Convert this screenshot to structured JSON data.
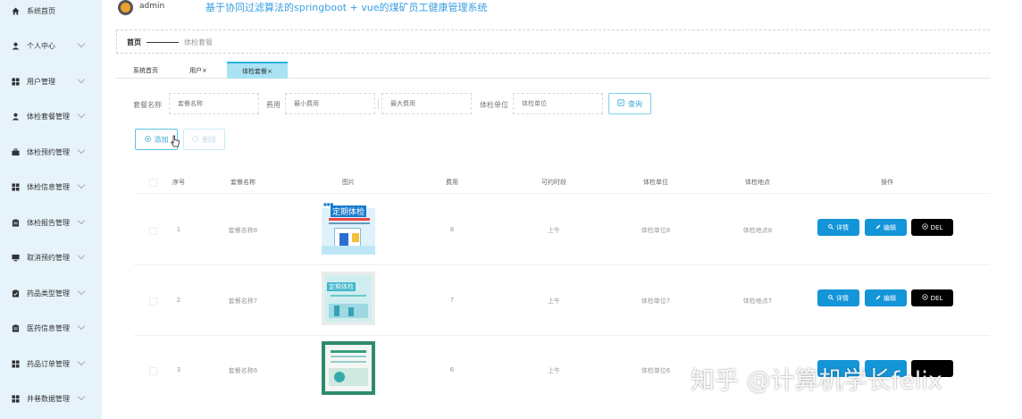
{
  "sidebar": {
    "items": [
      {
        "label": "系统首页",
        "icon": "home-icon",
        "chevron": false
      },
      {
        "label": "个人中心",
        "icon": "user-icon",
        "chevron": true
      },
      {
        "label": "用户管理",
        "icon": "grid-icon",
        "chevron": true
      },
      {
        "label": "体检套餐管理",
        "icon": "user-icon",
        "chevron": true
      },
      {
        "label": "体检预约管理",
        "icon": "briefcase-icon",
        "chevron": true
      },
      {
        "label": "体检信息管理",
        "icon": "grid-icon",
        "chevron": true
      },
      {
        "label": "体检报告管理",
        "icon": "clipboard-icon",
        "chevron": true
      },
      {
        "label": "取消预约管理",
        "icon": "monitor-icon",
        "chevron": true
      },
      {
        "label": "药品类型管理",
        "icon": "clipboard-check-icon",
        "chevron": true
      },
      {
        "label": "医药信息管理",
        "icon": "clipboard-icon",
        "chevron": true
      },
      {
        "label": "药品订单管理",
        "icon": "grid-icon",
        "chevron": true
      },
      {
        "label": "井巷数据管理",
        "icon": "grid-icon",
        "chevron": true
      }
    ]
  },
  "header": {
    "username": "admin",
    "system_title": "基于协同过滤算法的springboot + vue的煤矿员工健康管理系统"
  },
  "breadcrumb": {
    "home": "首页",
    "current": "体检套餐"
  },
  "tabs": [
    {
      "label": "系统首页",
      "active": false
    },
    {
      "label": "用户×",
      "active": false
    },
    {
      "label": "体检套餐×",
      "active": true
    }
  ],
  "search": {
    "name_label": "套餐名称",
    "name_placeholder": "套餐名称",
    "fee_label": "费用",
    "min_fee_placeholder": "最小费用",
    "max_fee_placeholder": "最大费用",
    "unit_label": "体检单位",
    "unit_placeholder": "体检单位",
    "query_label": "查询"
  },
  "actions": {
    "add_label": "添加",
    "delete_label": "删除"
  },
  "table": {
    "headers": [
      "序号",
      "套餐名称",
      "图片",
      "费用",
      "可约时段",
      "体检单位",
      "体检地点",
      "操作"
    ],
    "rows": [
      {
        "index": "1",
        "name": "套餐名称8",
        "fee": "8",
        "slot": "上午",
        "unit": "体检单位8",
        "place": "体检地点8",
        "image": "定期体检"
      },
      {
        "index": "2",
        "name": "套餐名称7",
        "fee": "7",
        "slot": "上午",
        "unit": "体检单位7",
        "place": "体检地点7",
        "image": "定期体检"
      },
      {
        "index": "3",
        "name": "套餐名称6",
        "fee": "6",
        "slot": "上午",
        "unit": "体检单位6",
        "place": "",
        "image": ""
      }
    ],
    "op_view": "详情",
    "op_edit": "编辑",
    "op_del": "DEL"
  },
  "watermark": "知乎 @计算机学长felix",
  "colors": {
    "sidebar_bg": "#e6f3fb",
    "accent": "#1495d8",
    "title": "#3a9fe0",
    "tab_active": "#a8e2f3",
    "delete": "#000000"
  }
}
